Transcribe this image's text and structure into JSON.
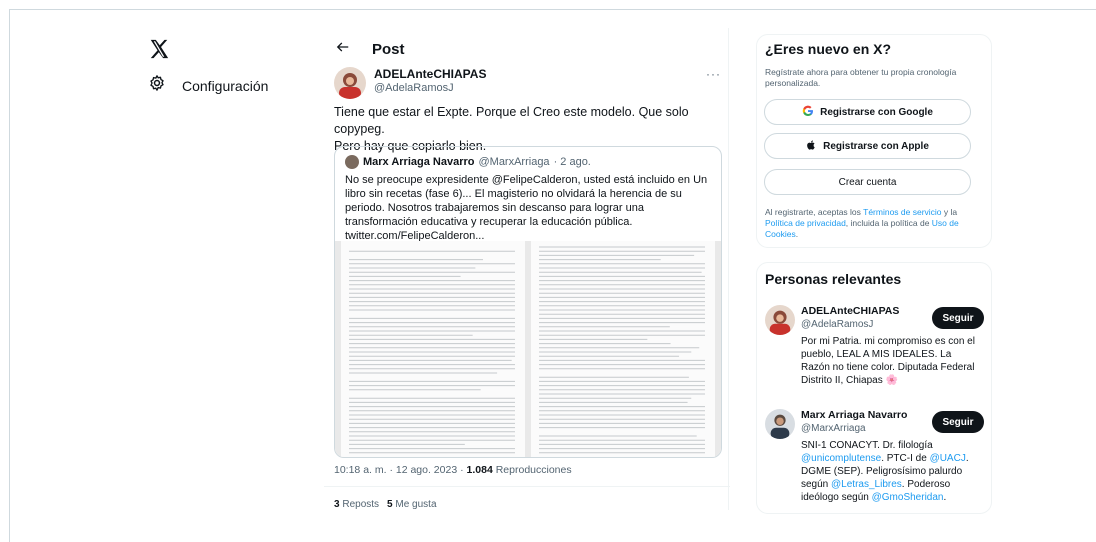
{
  "nav": {
    "logo_icon": "x-logo-icon",
    "settings_label": "Configuración",
    "settings_icon": "gear-icon"
  },
  "header": {
    "back_icon": "arrow-left-icon",
    "title": "Post"
  },
  "post": {
    "author_name": "ADELAnteCHIAPAS",
    "author_handle": "@AdelaRamosJ",
    "more_label": "···",
    "text_line1": "Tiene que estar el Expte. Porque el Creo este modelo. Que solo copypeg.",
    "text_line2": "Pero hay que copiarlo bien.",
    "quote": {
      "name": "Marx Arriaga Navarro",
      "handle": "@MarxArriaga",
      "date": "· 2 ago.",
      "text": "No se preocupe expresidente @FelipeCalderon, usted está incluido en Un libro sin recetas (fase 6)... El magisterio no olvidará la herencia de su periodo. Nosotros trabajaremos sin descanso para lograr una transformación educativa y recuperar la educación pública.  twitter.com/FelipeCalderon..."
    },
    "timestamp": "10:18 a. m. · 12 ago. 2023 · ",
    "views_count": "1.084",
    "views_label": "Reproducciones",
    "reposts_count": "3",
    "reposts_label": "Reposts",
    "likes_count": "5",
    "likes_label": "Me gusta"
  },
  "signup": {
    "title": "¿Eres nuevo en X?",
    "subtitle": "Regístrate ahora para obtener tu propia cronología personalizada.",
    "google_label": "Registrarse con Google",
    "apple_label": "Registrarse con Apple",
    "create_label": "Crear cuenta",
    "legal_prefix": "Al registrarte, aceptas los ",
    "terms_link": "Términos de servicio",
    "legal_mid1": " y la ",
    "privacy_link": "Política de privacidad",
    "legal_mid2": ", incluida la política de ",
    "cookies_link": "Uso de Cookies",
    "legal_suffix": "."
  },
  "people": {
    "title": "Personas relevantes",
    "follow_label": "Seguir",
    "list": [
      {
        "name": "ADELAnteCHIAPAS",
        "handle": "@AdelaRamosJ",
        "bio": "Por mi Patria. mi compromiso es con el pueblo, LEAL A MIS IDEALES. La Razón no tiene color. Diputada Federal Distrito II, Chiapas 🌸"
      },
      {
        "name": "Marx Arriaga Navarro",
        "handle": "@MarxArriaga",
        "bio_a": "SNI-1 CONACYT. Dr. filología ",
        "bio_link1": "@unicomplutense",
        "bio_b": ". PTC-I de ",
        "bio_link2": "@UACJ",
        "bio_c": ". DGME (SEP). Peligrosísimo palurdo según ",
        "bio_link3": "@Letras_Libres",
        "bio_d": ". Poderoso ideólogo según ",
        "bio_link4": "@GmoSheridan",
        "bio_e": "."
      }
    ]
  },
  "colors": {
    "accent": "#1d9bf0",
    "text": "#0f1419",
    "muted": "#536471",
    "border": "#cfd9de"
  }
}
